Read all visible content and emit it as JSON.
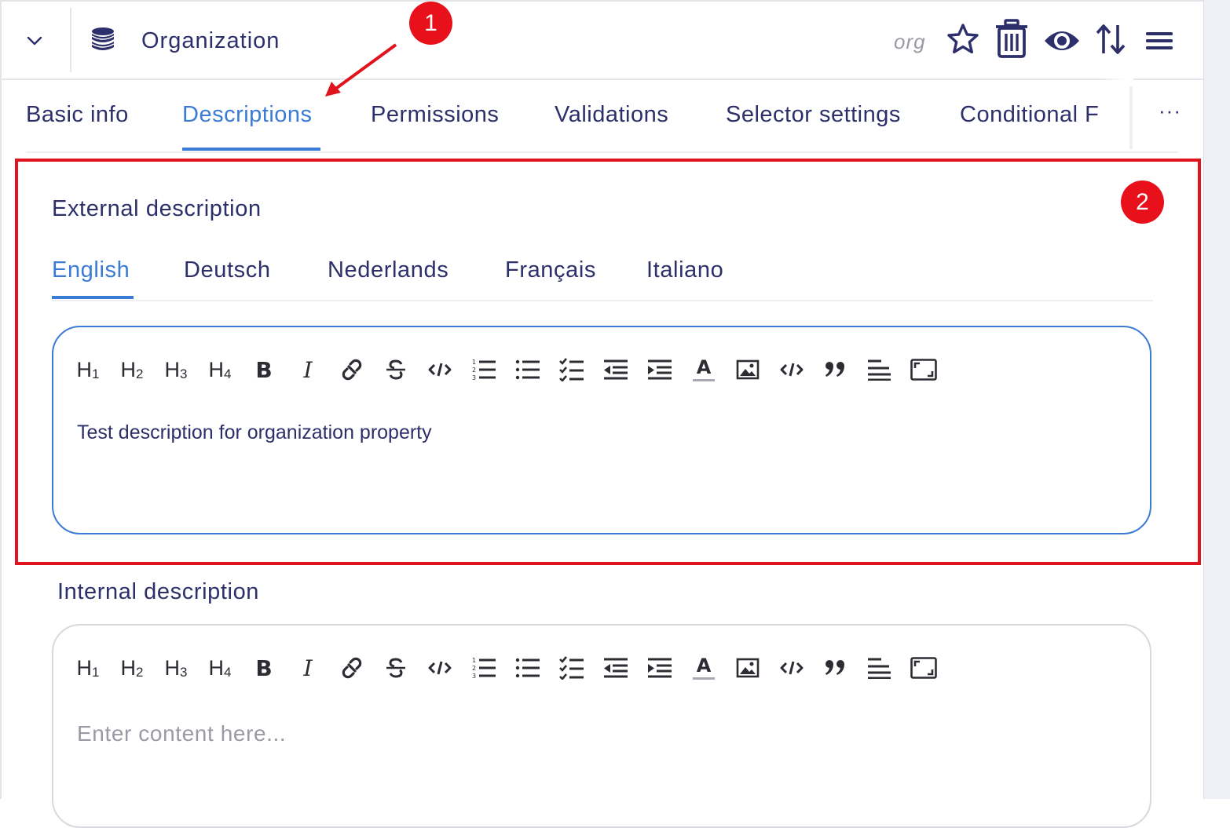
{
  "header": {
    "title": "Organization",
    "code": "org"
  },
  "tabs": [
    {
      "label": "Basic info"
    },
    {
      "label": "Descriptions"
    },
    {
      "label": "Permissions"
    },
    {
      "label": "Validations"
    },
    {
      "label": "Selector settings"
    },
    {
      "label": "Conditional F"
    }
  ],
  "tabs_more": "···",
  "annotations": {
    "badge1": "1",
    "badge2": "2"
  },
  "external": {
    "title": "External description",
    "languages": [
      "English",
      "Deutsch",
      "Nederlands",
      "Français",
      "Italiano"
    ],
    "content": "Test description for organization property"
  },
  "internal": {
    "title": "Internal description",
    "placeholder": "Enter content here..."
  },
  "toolbar_labels": {
    "h1": "H",
    "h2": "H",
    "h3": "H",
    "h4": "H",
    "h1_sub": "1",
    "h2_sub": "2",
    "h3_sub": "3",
    "h4_sub": "4",
    "bold": "B",
    "italic": "I",
    "text_color": "A"
  },
  "colors": {
    "accent": "#3a7bd5",
    "annotation": "#e0141e",
    "text": "#2d2f6b"
  }
}
